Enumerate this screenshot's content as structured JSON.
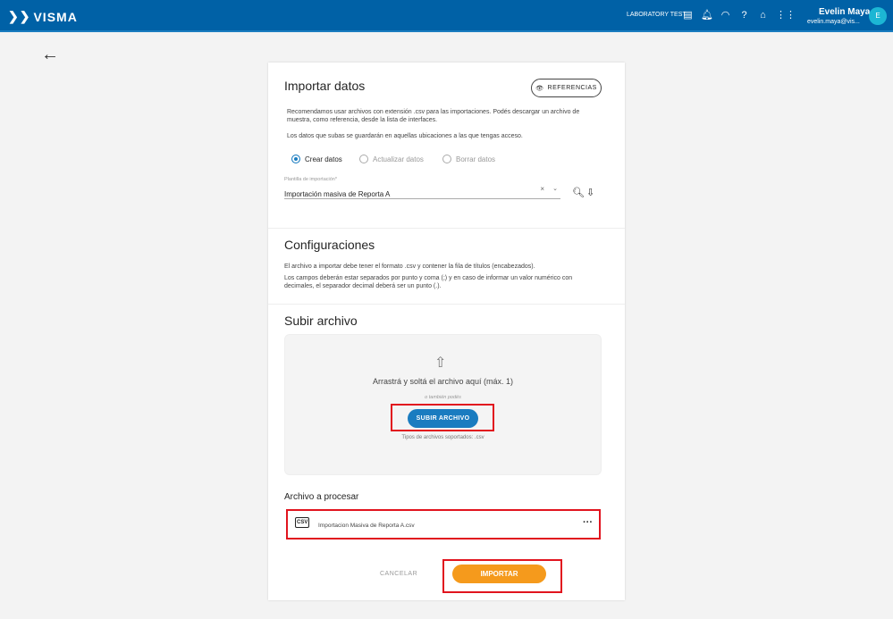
{
  "header": {
    "brand": "VISMA",
    "environment": "LABORATORY TEST",
    "user_name": "Evelin Maya",
    "user_email": "evelin.maya@vis...",
    "avatar_initial": "E"
  },
  "import": {
    "title": "Importar datos",
    "references_button": "REFERENCIAS",
    "desc1": "Recomendamos usar archivos con extensión .csv para las importaciones. Podés descargar un archivo de muestra, como referencia, desde la lista de interfaces.",
    "desc2": "Los datos que subas se guardarán en aquellas ubicaciones a las que tengas acceso.",
    "options": [
      {
        "label": "Crear datos",
        "selected": true
      },
      {
        "label": "Actualizar datos",
        "selected": false
      },
      {
        "label": "Borrar datos",
        "selected": false
      }
    ],
    "template_label": "Plantilla de importación*",
    "template_value": "Importación masiva de Reporta A"
  },
  "config": {
    "title": "Configuraciones",
    "text1": "El archivo a importar debe tener el formato .csv y contener la fila de títulos (encabezados).",
    "text2": "Los campos deberán estar separados por punto y coma (;) y en caso de informar un valor numérico con decimales, el separador decimal deberá ser un punto (.)."
  },
  "upload": {
    "title": "Subir archivo",
    "drop_text": "Arrastrá y soltá el archivo aquí (máx. 1)",
    "or_text": "o también podés",
    "button": "SUBIR ARCHIVO",
    "supported": "Tipos de archivos soportados: .csv"
  },
  "process": {
    "title": "Archivo a procesar",
    "file_name": "Importacion Masiva de Reporta A.csv",
    "file_icon_label": "CSV"
  },
  "actions": {
    "cancel": "CANCELAR",
    "import": "IMPORTAR"
  }
}
